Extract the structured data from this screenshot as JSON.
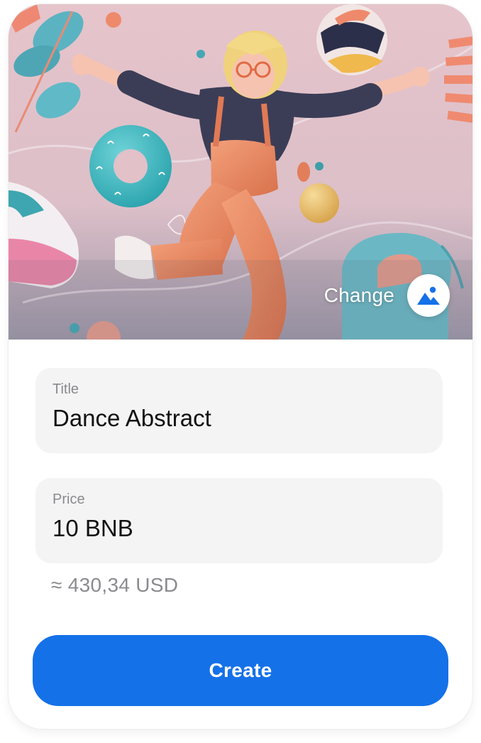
{
  "artwork": {
    "change_label": "Change",
    "change_icon": "image-icon"
  },
  "form": {
    "title_label": "Title",
    "title_value": "Dance Abstract",
    "price_label": "Price",
    "price_value": "10 BNB",
    "usd_estimate": "≈ 430,34 USD"
  },
  "actions": {
    "create_label": "Create"
  },
  "colors": {
    "accent": "#1571e8",
    "field_bg": "#f4f4f5",
    "artwork_bg": "#e8c9cf"
  }
}
